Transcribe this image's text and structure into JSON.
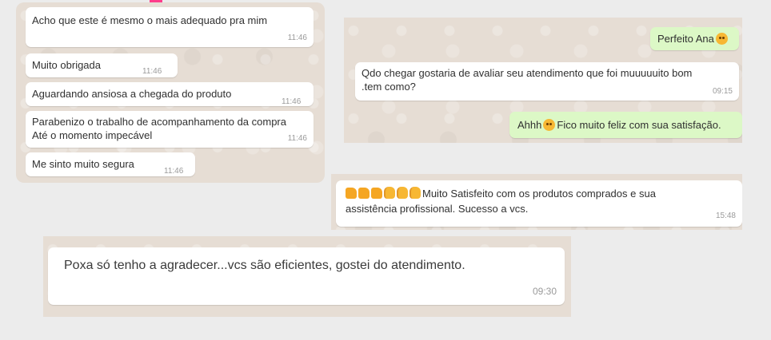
{
  "chat_left": {
    "messages": [
      {
        "text": "Acho que este é mesmo o mais adequado pra mim",
        "time": "11:46"
      },
      {
        "text": "Muito obrigada",
        "time": "11:46"
      },
      {
        "text": "Aguardando ansiosa a chegada do produto",
        "time": "11:46"
      },
      {
        "line1": "Parabenizo o trabalho de acompanhamento da compra",
        "line2": "Até o momento impecável",
        "time": "11:46"
      },
      {
        "text": "Me sinto muito segura",
        "time": "11:46"
      }
    ]
  },
  "chat_right": {
    "messages": [
      {
        "text": "Perfeito Ana",
        "emoji": "smirk-emoji",
        "direction": "out"
      },
      {
        "line1": "Qdo chegar gostaria de avaliar seu atendimento que foi muuuuuito bom",
        "line2": ".tem como?",
        "time": "09:15",
        "direction": "in"
      },
      {
        "text_before": "Ahhh",
        "emoji": "star-struck-emoji",
        "text_after": "Fico muito feliz com sua satisfação.",
        "direction": "out"
      }
    ]
  },
  "chat_middle": {
    "message": {
      "line1": "Muito Satisfeito com os produtos comprados e sua",
      "line2": "assistência profissional. Sucesso a vcs.",
      "time": "15:48",
      "emojis": [
        "thumbs-up",
        "thumbs-up",
        "thumbs-up",
        "clapping-hands",
        "clapping-hands",
        "clapping-hands"
      ]
    }
  },
  "chat_bottom": {
    "message": {
      "text": "Poxa só tenho a agradecer...vcs são eficientes, gostei do atendimento.",
      "time": "09:30"
    }
  },
  "colors": {
    "incoming": "#ffffff",
    "outgoing": "#dcf8c6",
    "wallpaper": "#e6ddd4",
    "page": "#ececec",
    "accent": "#ff3d8b"
  }
}
